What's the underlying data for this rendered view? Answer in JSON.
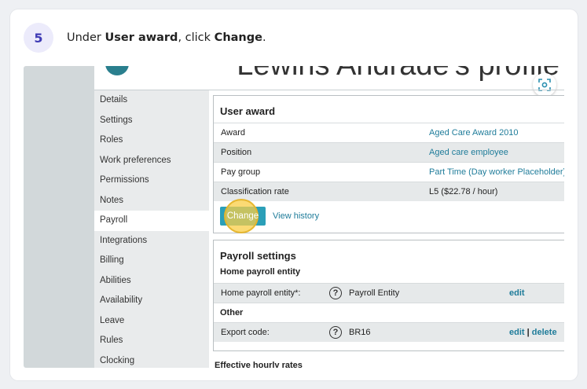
{
  "step": {
    "number": "5",
    "prefix": "Under ",
    "bold1": "User award",
    "middle": ", click ",
    "bold2": "Change",
    "suffix": "."
  },
  "header": {
    "profile_title": "Lewins Andrade's profile"
  },
  "menu": {
    "items": [
      {
        "label": "Details"
      },
      {
        "label": "Settings"
      },
      {
        "label": "Roles"
      },
      {
        "label": "Work preferences"
      },
      {
        "label": "Permissions"
      },
      {
        "label": "Notes"
      },
      {
        "label": "Payroll",
        "active": true
      },
      {
        "label": "Integrations"
      },
      {
        "label": "Billing"
      },
      {
        "label": "Abilities"
      },
      {
        "label": "Availability"
      },
      {
        "label": "Leave"
      },
      {
        "label": "Rules"
      },
      {
        "label": "Clocking"
      }
    ]
  },
  "user_award": {
    "title": "User award",
    "rows": [
      {
        "label": "Award",
        "value": "Aged Care Award 2010"
      },
      {
        "label": "Position",
        "value": "Aged care employee"
      },
      {
        "label": "Pay group",
        "value": "Part Time (Day worker Placeholder)"
      },
      {
        "label": "Classification rate",
        "value": "L5 ($22.78 / hour)"
      }
    ],
    "change_label": "Change",
    "view_history_label": "View history"
  },
  "payroll_settings": {
    "title": "Payroll settings",
    "home_heading": "Home payroll entity",
    "home_label": "Home payroll entity*:",
    "home_value": "Payroll Entity",
    "home_edit": "edit",
    "other_heading": "Other",
    "export_label": "Export code:",
    "export_value": "BR16",
    "export_edit": "edit",
    "export_separator": "|",
    "export_delete": "delete",
    "help_glyph": "?"
  },
  "effective_rates_label": "Effective hourly rates",
  "colors": {
    "accent": "#2b9fb8",
    "link": "#1f7c9a",
    "badge_bg": "#ecebfb",
    "badge_text": "#3f3bb5",
    "highlight": "#face46"
  }
}
